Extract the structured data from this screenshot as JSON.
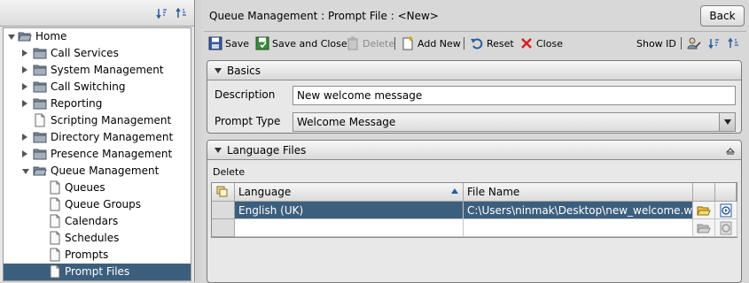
{
  "title": "Queue Management : Prompt File : <New>",
  "back_label": "Back",
  "toolbar": {
    "save": "Save",
    "save_close": "Save and Close",
    "delete": "Delete",
    "add_new": "Add New",
    "reset": "Reset",
    "close": "Close",
    "show_id": "Show ID"
  },
  "tree": {
    "items": [
      {
        "label": "Home"
      },
      {
        "label": "Call Services"
      },
      {
        "label": "System Management"
      },
      {
        "label": "Call Switching"
      },
      {
        "label": "Reporting"
      },
      {
        "label": "Scripting Management"
      },
      {
        "label": "Directory Management"
      },
      {
        "label": "Presence Management"
      },
      {
        "label": "Queue Management"
      },
      {
        "label": "Queues"
      },
      {
        "label": "Queue Groups"
      },
      {
        "label": "Calendars"
      },
      {
        "label": "Schedules"
      },
      {
        "label": "Prompts"
      },
      {
        "label": "Prompt Files"
      }
    ]
  },
  "basics": {
    "header": "Basics",
    "description_label": "Description",
    "description_value": "New welcome message",
    "prompt_type_label": "Prompt Type",
    "prompt_type_value": "Welcome Message"
  },
  "language_files": {
    "header": "Language Files",
    "delete_label": "Delete",
    "columns": {
      "language": "Language",
      "file_name": "File Name"
    },
    "rows": [
      {
        "language": "English (UK)",
        "file_name": "C:\\Users\\ninmak\\Desktop\\new_welcome.wav"
      }
    ]
  },
  "colors": {
    "selection": "#3d5f7e",
    "folder": "#6b7c8c"
  }
}
